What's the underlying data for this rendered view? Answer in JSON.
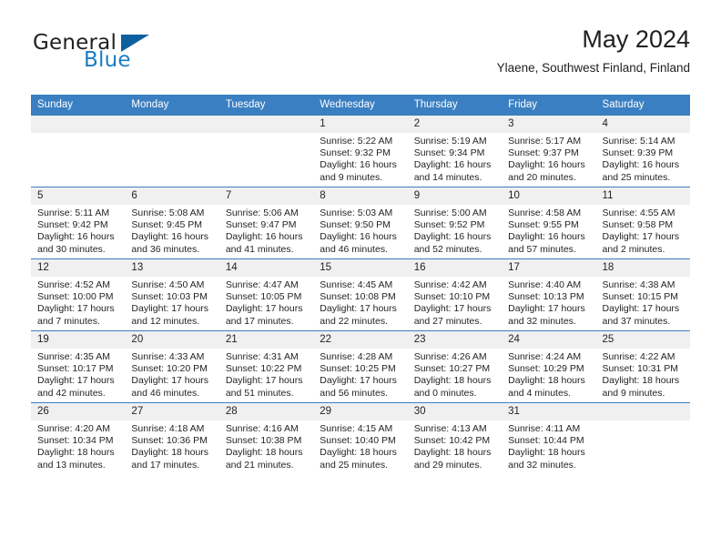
{
  "brand": {
    "name_part1": "General",
    "name_part2": "Blue",
    "triangle_color": "#0e5f9e",
    "blue_color": "#1b7cc2"
  },
  "header": {
    "month_title": "May 2024",
    "location": "Ylaene, Southwest Finland, Finland"
  },
  "theme": {
    "header_bg": "#3a7fc1",
    "daynum_bg": "#f0f0f0",
    "text": "#231f20"
  },
  "weekday_headers": [
    "Sunday",
    "Monday",
    "Tuesday",
    "Wednesday",
    "Thursday",
    "Friday",
    "Saturday"
  ],
  "labels": {
    "sunrise_prefix": "Sunrise:",
    "sunset_prefix": "Sunset:",
    "daylight_prefix": "Daylight:"
  },
  "weeks": [
    [
      {
        "day": "",
        "empty": true
      },
      {
        "day": "",
        "empty": true
      },
      {
        "day": "",
        "empty": true
      },
      {
        "day": "1",
        "sunrise": "Sunrise: 5:22 AM",
        "sunset": "Sunset: 9:32 PM",
        "daylight_line1": "Daylight: 16 hours",
        "daylight_line2": "and 9 minutes."
      },
      {
        "day": "2",
        "sunrise": "Sunrise: 5:19 AM",
        "sunset": "Sunset: 9:34 PM",
        "daylight_line1": "Daylight: 16 hours",
        "daylight_line2": "and 14 minutes."
      },
      {
        "day": "3",
        "sunrise": "Sunrise: 5:17 AM",
        "sunset": "Sunset: 9:37 PM",
        "daylight_line1": "Daylight: 16 hours",
        "daylight_line2": "and 20 minutes."
      },
      {
        "day": "4",
        "sunrise": "Sunrise: 5:14 AM",
        "sunset": "Sunset: 9:39 PM",
        "daylight_line1": "Daylight: 16 hours",
        "daylight_line2": "and 25 minutes."
      }
    ],
    [
      {
        "day": "5",
        "sunrise": "Sunrise: 5:11 AM",
        "sunset": "Sunset: 9:42 PM",
        "daylight_line1": "Daylight: 16 hours",
        "daylight_line2": "and 30 minutes."
      },
      {
        "day": "6",
        "sunrise": "Sunrise: 5:08 AM",
        "sunset": "Sunset: 9:45 PM",
        "daylight_line1": "Daylight: 16 hours",
        "daylight_line2": "and 36 minutes."
      },
      {
        "day": "7",
        "sunrise": "Sunrise: 5:06 AM",
        "sunset": "Sunset: 9:47 PM",
        "daylight_line1": "Daylight: 16 hours",
        "daylight_line2": "and 41 minutes."
      },
      {
        "day": "8",
        "sunrise": "Sunrise: 5:03 AM",
        "sunset": "Sunset: 9:50 PM",
        "daylight_line1": "Daylight: 16 hours",
        "daylight_line2": "and 46 minutes."
      },
      {
        "day": "9",
        "sunrise": "Sunrise: 5:00 AM",
        "sunset": "Sunset: 9:52 PM",
        "daylight_line1": "Daylight: 16 hours",
        "daylight_line2": "and 52 minutes."
      },
      {
        "day": "10",
        "sunrise": "Sunrise: 4:58 AM",
        "sunset": "Sunset: 9:55 PM",
        "daylight_line1": "Daylight: 16 hours",
        "daylight_line2": "and 57 minutes."
      },
      {
        "day": "11",
        "sunrise": "Sunrise: 4:55 AM",
        "sunset": "Sunset: 9:58 PM",
        "daylight_line1": "Daylight: 17 hours",
        "daylight_line2": "and 2 minutes."
      }
    ],
    [
      {
        "day": "12",
        "sunrise": "Sunrise: 4:52 AM",
        "sunset": "Sunset: 10:00 PM",
        "daylight_line1": "Daylight: 17 hours",
        "daylight_line2": "and 7 minutes."
      },
      {
        "day": "13",
        "sunrise": "Sunrise: 4:50 AM",
        "sunset": "Sunset: 10:03 PM",
        "daylight_line1": "Daylight: 17 hours",
        "daylight_line2": "and 12 minutes."
      },
      {
        "day": "14",
        "sunrise": "Sunrise: 4:47 AM",
        "sunset": "Sunset: 10:05 PM",
        "daylight_line1": "Daylight: 17 hours",
        "daylight_line2": "and 17 minutes."
      },
      {
        "day": "15",
        "sunrise": "Sunrise: 4:45 AM",
        "sunset": "Sunset: 10:08 PM",
        "daylight_line1": "Daylight: 17 hours",
        "daylight_line2": "and 22 minutes."
      },
      {
        "day": "16",
        "sunrise": "Sunrise: 4:42 AM",
        "sunset": "Sunset: 10:10 PM",
        "daylight_line1": "Daylight: 17 hours",
        "daylight_line2": "and 27 minutes."
      },
      {
        "day": "17",
        "sunrise": "Sunrise: 4:40 AM",
        "sunset": "Sunset: 10:13 PM",
        "daylight_line1": "Daylight: 17 hours",
        "daylight_line2": "and 32 minutes."
      },
      {
        "day": "18",
        "sunrise": "Sunrise: 4:38 AM",
        "sunset": "Sunset: 10:15 PM",
        "daylight_line1": "Daylight: 17 hours",
        "daylight_line2": "and 37 minutes."
      }
    ],
    [
      {
        "day": "19",
        "sunrise": "Sunrise: 4:35 AM",
        "sunset": "Sunset: 10:17 PM",
        "daylight_line1": "Daylight: 17 hours",
        "daylight_line2": "and 42 minutes."
      },
      {
        "day": "20",
        "sunrise": "Sunrise: 4:33 AM",
        "sunset": "Sunset: 10:20 PM",
        "daylight_line1": "Daylight: 17 hours",
        "daylight_line2": "and 46 minutes."
      },
      {
        "day": "21",
        "sunrise": "Sunrise: 4:31 AM",
        "sunset": "Sunset: 10:22 PM",
        "daylight_line1": "Daylight: 17 hours",
        "daylight_line2": "and 51 minutes."
      },
      {
        "day": "22",
        "sunrise": "Sunrise: 4:28 AM",
        "sunset": "Sunset: 10:25 PM",
        "daylight_line1": "Daylight: 17 hours",
        "daylight_line2": "and 56 minutes."
      },
      {
        "day": "23",
        "sunrise": "Sunrise: 4:26 AM",
        "sunset": "Sunset: 10:27 PM",
        "daylight_line1": "Daylight: 18 hours",
        "daylight_line2": "and 0 minutes."
      },
      {
        "day": "24",
        "sunrise": "Sunrise: 4:24 AM",
        "sunset": "Sunset: 10:29 PM",
        "daylight_line1": "Daylight: 18 hours",
        "daylight_line2": "and 4 minutes."
      },
      {
        "day": "25",
        "sunrise": "Sunrise: 4:22 AM",
        "sunset": "Sunset: 10:31 PM",
        "daylight_line1": "Daylight: 18 hours",
        "daylight_line2": "and 9 minutes."
      }
    ],
    [
      {
        "day": "26",
        "sunrise": "Sunrise: 4:20 AM",
        "sunset": "Sunset: 10:34 PM",
        "daylight_line1": "Daylight: 18 hours",
        "daylight_line2": "and 13 minutes."
      },
      {
        "day": "27",
        "sunrise": "Sunrise: 4:18 AM",
        "sunset": "Sunset: 10:36 PM",
        "daylight_line1": "Daylight: 18 hours",
        "daylight_line2": "and 17 minutes."
      },
      {
        "day": "28",
        "sunrise": "Sunrise: 4:16 AM",
        "sunset": "Sunset: 10:38 PM",
        "daylight_line1": "Daylight: 18 hours",
        "daylight_line2": "and 21 minutes."
      },
      {
        "day": "29",
        "sunrise": "Sunrise: 4:15 AM",
        "sunset": "Sunset: 10:40 PM",
        "daylight_line1": "Daylight: 18 hours",
        "daylight_line2": "and 25 minutes."
      },
      {
        "day": "30",
        "sunrise": "Sunrise: 4:13 AM",
        "sunset": "Sunset: 10:42 PM",
        "daylight_line1": "Daylight: 18 hours",
        "daylight_line2": "and 29 minutes."
      },
      {
        "day": "31",
        "sunrise": "Sunrise: 4:11 AM",
        "sunset": "Sunset: 10:44 PM",
        "daylight_line1": "Daylight: 18 hours",
        "daylight_line2": "and 32 minutes."
      },
      {
        "day": "",
        "empty": true
      }
    ]
  ]
}
